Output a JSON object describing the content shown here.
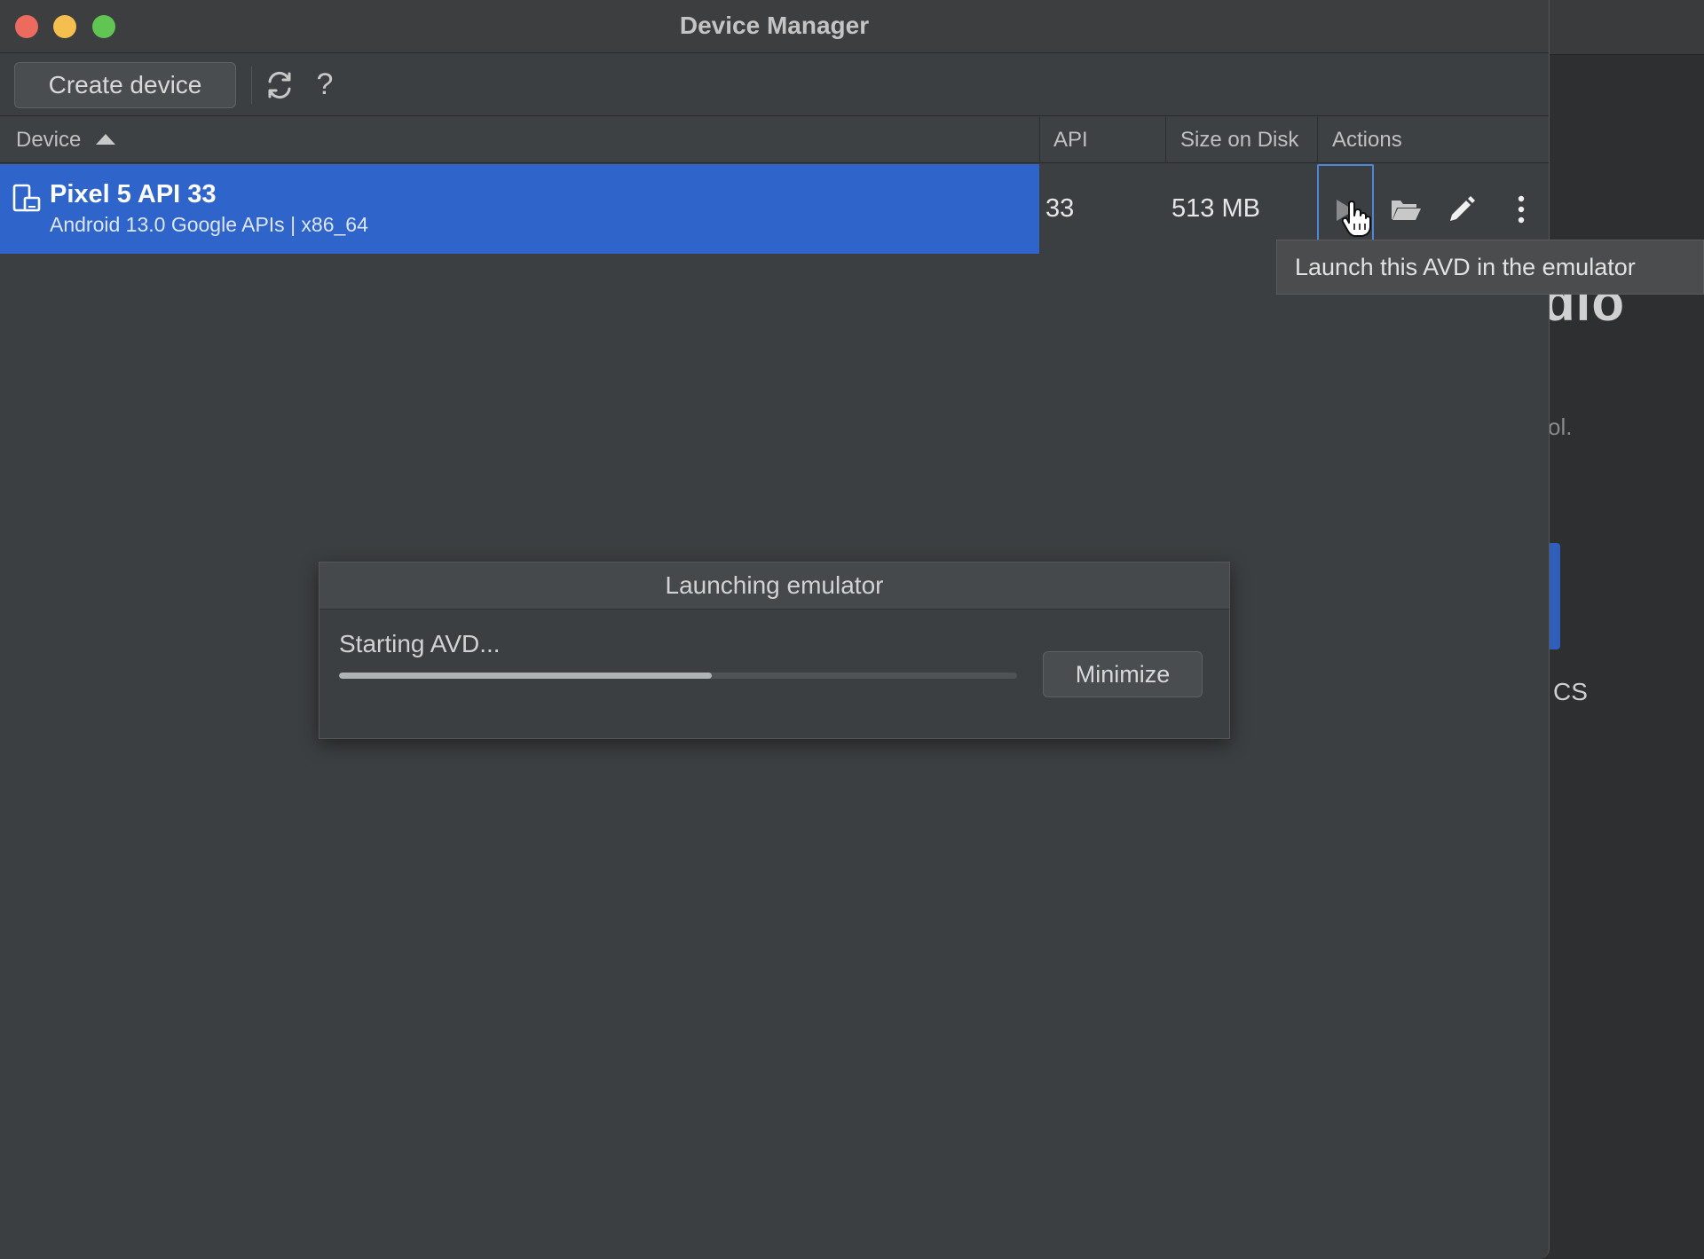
{
  "window": {
    "title": "Device Manager"
  },
  "toolbar": {
    "create_label": "Create device",
    "help_label": "?"
  },
  "table": {
    "headers": {
      "device": "Device",
      "api": "API",
      "size": "Size on Disk",
      "actions": "Actions"
    },
    "rows": [
      {
        "name": "Pixel 5 API 33",
        "subtitle": "Android 13.0 Google APIs | x86_64",
        "api": "33",
        "size": "513 MB"
      }
    ]
  },
  "tooltip": {
    "text": "Launch this AVD in the emulator"
  },
  "dialog": {
    "title": "Launching emulator",
    "status": "Starting AVD...",
    "progress": 0.55,
    "minimize_label": "Minimize"
  },
  "background": {
    "big_text": "dio",
    "small_text": "ol.",
    "cs_text": "CS"
  },
  "colors": {
    "selection": "#2f65ca",
    "window_bg": "#3c3f41"
  }
}
